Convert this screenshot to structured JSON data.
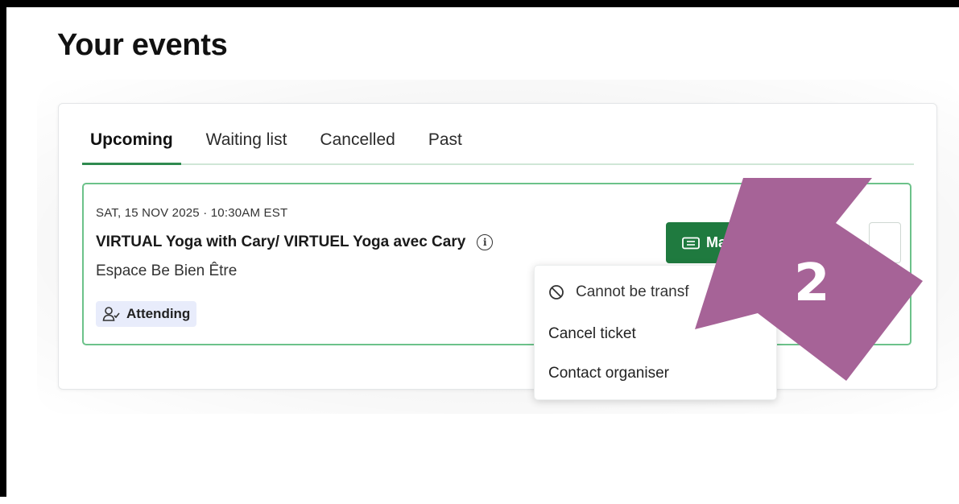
{
  "page": {
    "title": "Your events"
  },
  "tabs": [
    {
      "label": "Upcoming",
      "active": true
    },
    {
      "label": "Waiting list",
      "active": false
    },
    {
      "label": "Cancelled",
      "active": false
    },
    {
      "label": "Past",
      "active": false
    }
  ],
  "event": {
    "datetime": "SAT, 15 NOV 2025 · 10:30AM EST",
    "title": "VIRTUAL Yoga with Cary/ VIRTUEL Yoga avec Cary",
    "info_icon": "info-icon",
    "venue": "Espace Be Bien Être",
    "status_badge": "Attending",
    "status_icon": "person-check-icon",
    "manage_label": "Ma",
    "manage_icon": "ticket-icon"
  },
  "menu": {
    "items": [
      {
        "label": "Cannot be transf",
        "icon": "ban-icon",
        "enabled": false
      },
      {
        "label": "Cancel ticket",
        "enabled": true
      },
      {
        "label": "Contact organiser",
        "enabled": true
      }
    ]
  },
  "annotation": {
    "number": "2",
    "color": "#a66397"
  },
  "colors": {
    "accent_green": "#1f7a3f",
    "event_border": "#6cc28a",
    "badge_bg": "#e8ecfb"
  }
}
